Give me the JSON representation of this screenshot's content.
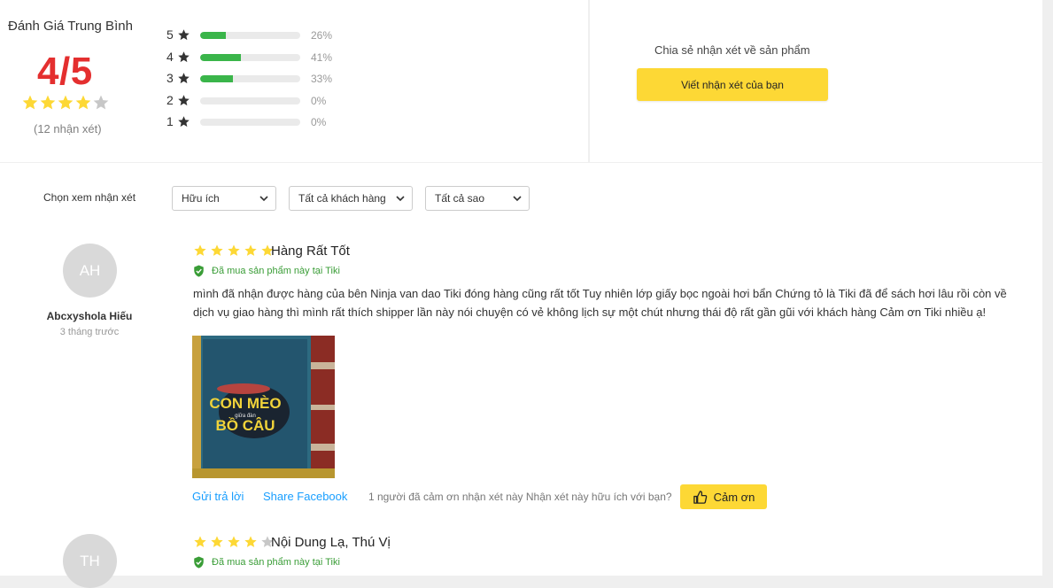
{
  "summary": {
    "title": "Đánh Giá Trung Bình",
    "score": "4/5",
    "stars": 4,
    "count_label": "(12 nhận xét)",
    "distribution": [
      {
        "stars": "5",
        "percent": 26,
        "percent_label": "26%"
      },
      {
        "stars": "4",
        "percent": 41,
        "percent_label": "41%"
      },
      {
        "stars": "3",
        "percent": 33,
        "percent_label": "33%"
      },
      {
        "stars": "2",
        "percent": 0,
        "percent_label": "0%"
      },
      {
        "stars": "1",
        "percent": 0,
        "percent_label": "0%"
      }
    ]
  },
  "share": {
    "label": "Chia sẻ nhận xét về sản phẩm",
    "button": "Viết nhận xét của bạn"
  },
  "filters": {
    "label": "Chọn xem nhận xét",
    "options": [
      "Hữu ích",
      "Tất cả khách hàng",
      "Tất cả sao"
    ]
  },
  "reviews": [
    {
      "initials": "AH",
      "name": "Abcxyshola Hiếu",
      "time": "3 tháng trước",
      "stars": 5,
      "title": "Hàng Rất Tốt",
      "verified": "Đã mua sản phẩm này tại Tiki",
      "content": "mình đã nhận được hàng của bên Ninja van dao Tiki đóng hàng cũng rất tốt Tuy nhiên lớp giấy bọc ngoài hơi bẩn Chứng tỏ là Tiki đã để sách hơi lâu rồi còn về dịch vụ giao hàng thì mình rất thích shipper lần này nói chuyện có vẻ không lịch sự một chút nhưng thái độ rất gần gũi với khách hàng Cảm ơn Tiki nhiều ạ!",
      "image_text": {
        "line1": "CON MÈO",
        "line2": "giữa đàn",
        "line3": "BỒ CÂU"
      },
      "reply": "Gửi trả lời",
      "share": "Share Facebook",
      "thanks_text": "1 người đã cảm ơn nhận xét này Nhận xét này hữu ích với bạn?",
      "thanks_button": "Cảm ơn"
    },
    {
      "initials": "TH",
      "stars": 4,
      "title": "Nội Dung Lạ, Thú Vị",
      "verified": "Đã mua sản phẩm này tại Tiki"
    }
  ],
  "colors": {
    "star_filled": "#fdd835",
    "star_empty": "#c7c7c7",
    "score_red": "#e42f2f",
    "bar_green": "#3ab54a",
    "link_blue": "#189eff",
    "verified_green": "#3a9d37",
    "button_yellow": "#fdd835"
  },
  "icons": {
    "star": "star-icon",
    "chevron": "chevron-down-icon",
    "verified": "shield-check-icon",
    "like": "thumbs-up-icon"
  }
}
